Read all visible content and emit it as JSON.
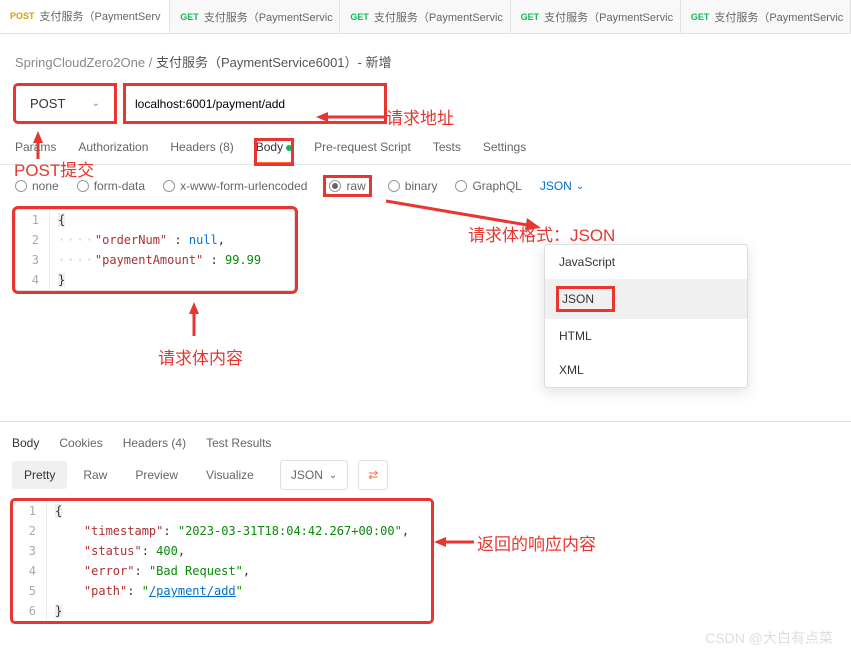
{
  "tabs": [
    {
      "method": "POST",
      "label": "支付服务（PaymentServ"
    },
    {
      "method": "GET",
      "label": "支付服务（PaymentServic"
    },
    {
      "method": "GET",
      "label": "支付服务（PaymentServic"
    },
    {
      "method": "GET",
      "label": "支付服务（PaymentServic"
    },
    {
      "method": "GET",
      "label": "支付服务（PaymentServic"
    }
  ],
  "breadcrumb": {
    "root": "SpringCloudZero2One",
    "sep": "/",
    "current": "支付服务（PaymentService6001）- 新增"
  },
  "request": {
    "method": "POST",
    "url": "localhost:6001/payment/add",
    "tabs": {
      "params": "Params",
      "auth": "Authorization",
      "headers": "Headers (8)",
      "body": "Body",
      "prereq": "Pre-request Script",
      "tests": "Tests",
      "settings": "Settings"
    },
    "bodyTypes": {
      "none": "none",
      "formdata": "form-data",
      "urlencoded": "x-www-form-urlencoded",
      "raw": "raw",
      "binary": "binary",
      "graphql": "GraphQL"
    },
    "rawFormat": "JSON",
    "body_lines": [
      "1",
      "2",
      "3",
      "4"
    ],
    "body": {
      "k1": "\"orderNum\"",
      "v1": "null",
      "k2": "\"paymentAmount\"",
      "v2": "99.99"
    }
  },
  "dropdown": {
    "items": [
      "JavaScript",
      "JSON",
      "HTML",
      "XML"
    ],
    "selected": "JSON"
  },
  "annotations": {
    "url": "请求地址",
    "method": "POST提交",
    "bodyFormat": "请求体格式：JSON",
    "bodyContent": "请求体内容",
    "response": "返回的响应内容"
  },
  "response": {
    "tabs": {
      "body": "Body",
      "cookies": "Cookies",
      "headers": "Headers (4)",
      "tests": "Test Results"
    },
    "toolbar": {
      "pretty": "Pretty",
      "raw": "Raw",
      "preview": "Preview",
      "visualize": "Visualize",
      "format": "JSON"
    },
    "lines": [
      "1",
      "2",
      "3",
      "4",
      "5",
      "6"
    ],
    "json": {
      "k1": "\"timestamp\"",
      "v1": "\"2023-03-31T18:04:42.267+00:00\"",
      "k2": "\"status\"",
      "v2": "400",
      "k3": "\"error\"",
      "v3": "\"Bad Request\"",
      "k4": "\"path\"",
      "v4": "\"",
      "v4b": "/payment/add",
      "v4c": "\""
    }
  },
  "watermark": "CSDN @大白有点菜"
}
